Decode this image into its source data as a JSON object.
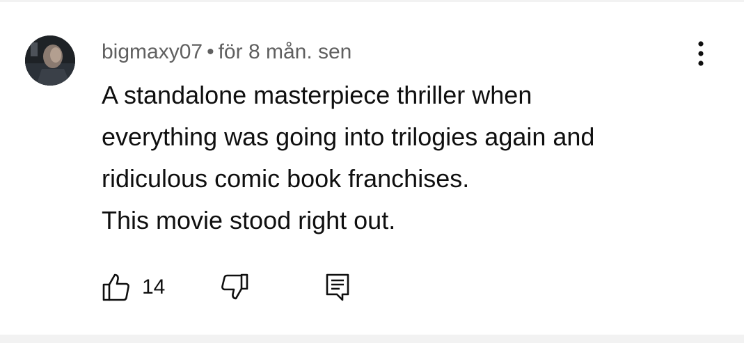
{
  "comment": {
    "author": "bigmaxy07",
    "separator": "•",
    "time": "för 8 mån. sen",
    "lines": [
      "A standalone masterpiece thriller when",
      "everything was going into trilogies again and",
      "ridiculous comic book franchises.",
      "This movie stood right out."
    ],
    "likes": "14"
  },
  "icons": {
    "avatar": "avatar-image",
    "more": "more-vert-icon",
    "like": "thumbs-up-icon",
    "dislike": "thumbs-down-icon",
    "reply": "reply-comment-icon"
  }
}
